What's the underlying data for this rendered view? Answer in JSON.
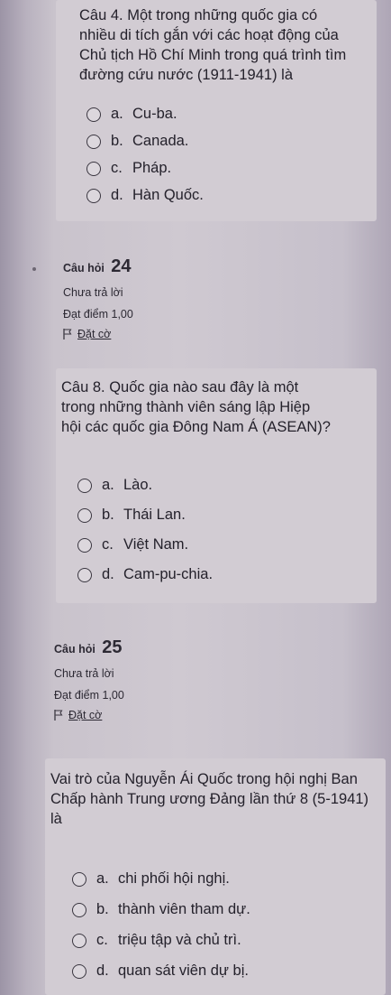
{
  "q_prev": {
    "text": "Câu 4. Một trong những quốc gia có nhiều di tích gắn với các hoạt động của Chủ tịch Hồ Chí Minh trong quá trình tìm đường cứu nước (1911-1941) là",
    "options": [
      {
        "letter": "a.",
        "text": "Cu-ba."
      },
      {
        "letter": "b.",
        "text": "Canada."
      },
      {
        "letter": "c.",
        "text": "Pháp."
      },
      {
        "letter": "d.",
        "text": "Hàn Quốc."
      }
    ]
  },
  "q24": {
    "label": "Câu hỏi",
    "number": "24",
    "status": "Chưa trả lời",
    "score": "Đạt điểm 1,00",
    "flag": "Đặt cờ",
    "text": "Câu 8. Quốc gia nào sau đây là một trong những thành viên sáng lập Hiệp hội các quốc gia Đông Nam Á (ASEAN)?",
    "options": [
      {
        "letter": "a.",
        "text": "Lào."
      },
      {
        "letter": "b.",
        "text": "Thái Lan."
      },
      {
        "letter": "c.",
        "text": "Việt Nam."
      },
      {
        "letter": "d.",
        "text": "Cam-pu-chia."
      }
    ]
  },
  "q25": {
    "label": "Câu hỏi",
    "number": "25",
    "status": "Chưa trả lời",
    "score": "Đạt điểm 1,00",
    "flag": "Đặt cờ",
    "text": "Vai trò của Nguyễn Ái Quốc trong hội nghị Ban Chấp hành Trung ương Đảng lần thứ 8 (5-1941) là",
    "options": [
      {
        "letter": "a.",
        "text": "chi phối hội nghị."
      },
      {
        "letter": "b.",
        "text": "thành viên tham dự."
      },
      {
        "letter": "c.",
        "text": "triệu tập và chủ trì."
      },
      {
        "letter": "d.",
        "text": "quan sát viên dự bị."
      }
    ]
  }
}
